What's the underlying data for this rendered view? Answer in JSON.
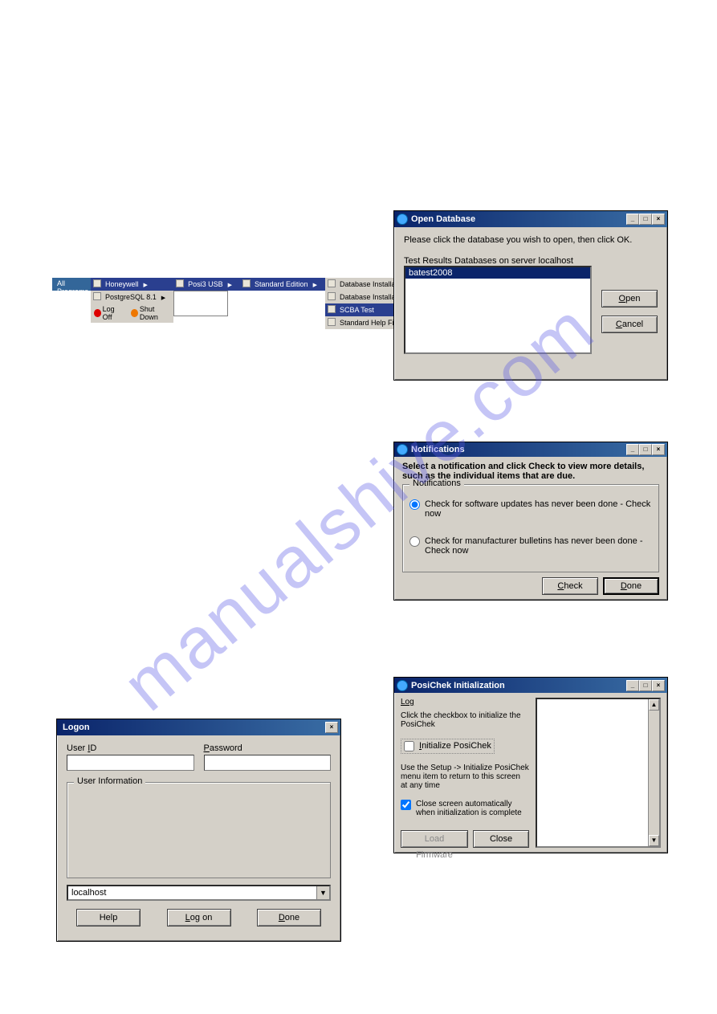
{
  "watermark": "manualshive.com",
  "start_menu": {
    "all_programs": "All Programs",
    "col1": [
      "Honeywell",
      "PostgreSQL 8.1"
    ],
    "col2": [
      "Posi3 USB"
    ],
    "col3": [
      "Standard Edition"
    ],
    "col4": [
      "Database Installation Wizard",
      "Database Installation Wizard Help",
      "SCBA Test",
      "Standard Help File"
    ],
    "logoff": "Log Off",
    "shutdown": "Shut Down"
  },
  "open_db": {
    "title": "Open Database",
    "instruction": "Please click the database you wish to open, then click OK.",
    "list_label": "Test Results Databases on server localhost",
    "items": [
      "batest2008"
    ],
    "open": "Open",
    "cancel": "Cancel"
  },
  "notifications": {
    "title": "Notifications",
    "header": "Select a notification and click Check to view more details, such as the individual items that are due.",
    "group": "Notifications",
    "option1": "Check for software updates has never been done - Check now",
    "option2": "Check for manufacturer bulletins has never been done - Check now",
    "check": "Check",
    "done": "Done"
  },
  "logon": {
    "title": "Logon",
    "user_id": "User ID",
    "password": "Password",
    "user_info": "User Information",
    "server": "localhost",
    "help": "Help",
    "logon_btn": "Log on",
    "done": "Done"
  },
  "posi": {
    "title": "PosiChek Initialization",
    "log": "Log",
    "instr1": "Click the checkbox to initialize the PosiChek",
    "init_label": "Initialize PosiChek",
    "instr2": "Use the Setup -> Initialize PosiChek menu item to return to this screen at any time",
    "auto_close": "Close screen automatically when initialization is complete",
    "load_fw": "Load Firmware",
    "close": "Close"
  }
}
